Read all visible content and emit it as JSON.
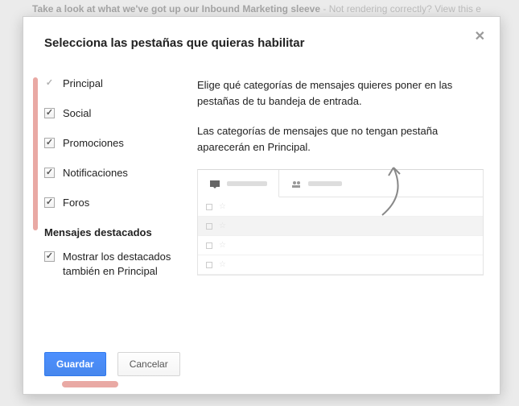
{
  "background": {
    "preview_line": "Take a look at what we've got up our Inbound Marketing sleeve",
    "preview_after": " - Not rendering correctly? View this e"
  },
  "dialog": {
    "title": "Selecciona las pestañas que quieras habilitar",
    "tabs": {
      "items": [
        {
          "label": "Principal",
          "locked": true
        },
        {
          "label": "Social",
          "locked": false
        },
        {
          "label": "Promociones",
          "locked": false
        },
        {
          "label": "Notificaciones",
          "locked": false
        },
        {
          "label": "Foros",
          "locked": false
        }
      ]
    },
    "starred": {
      "heading": "Mensajes destacados",
      "option": "Mostrar los destacados también en Principal"
    },
    "description": {
      "p1": "Elige qué categorías de mensajes quieres poner en las pestañas de tu bandeja de entrada.",
      "p2": "Las categorías de mensajes que no tengan pestaña aparecerán en Principal."
    },
    "buttons": {
      "save": "Guardar",
      "cancel": "Cancelar"
    }
  }
}
